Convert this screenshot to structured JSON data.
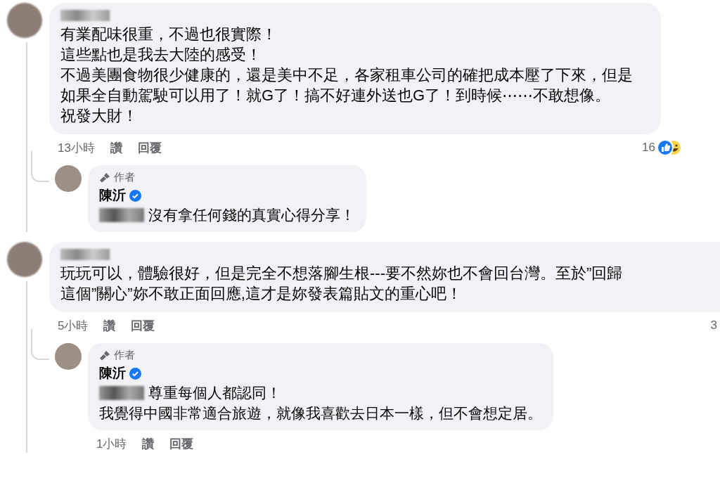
{
  "comments": [
    {
      "lines": [
        "有業配味很重，不過也很實際！",
        "這些點也是我去大陸的感受！",
        "不過美團食物很少健康的，還是美中不足，各家租車公司的確把成本壓了下來，但是",
        "如果全自動駕駛可以用了！就G了！搞不好連外送也G了！到時候⋯⋯不敢想像。",
        "祝發大財！"
      ],
      "time": "13小時",
      "like": "讚",
      "reply": "回覆",
      "reaction_count": "16",
      "reaction_icons": true,
      "replies": [
        {
          "badge": "作者",
          "author": "陳沂",
          "verified": true,
          "mention_tag": true,
          "lines": [
            "沒有拿任何錢的真實心得分享！"
          ]
        }
      ]
    },
    {
      "lines": [
        "玩玩可以，體驗很好，但是完全不想落腳生根---要不然妳也不會回台灣。至於”回歸",
        "這個”關心”妳不敢正面回應,這才是妳發表篇貼文的重心吧！"
      ],
      "time": "5小時",
      "like": "讚",
      "reply": "回覆",
      "reaction_count": "3",
      "reaction_icons": false,
      "replies": [
        {
          "badge": "作者",
          "author": "陳沂",
          "verified": true,
          "mention_tag": true,
          "lines": [
            "尊重每個人都認同！",
            "我覺得中國非常適合旅遊，就像我喜歡去日本一樣，但不會想定居。"
          ],
          "time": "1小時",
          "like": "讚",
          "reply": "回覆"
        }
      ]
    }
  ]
}
